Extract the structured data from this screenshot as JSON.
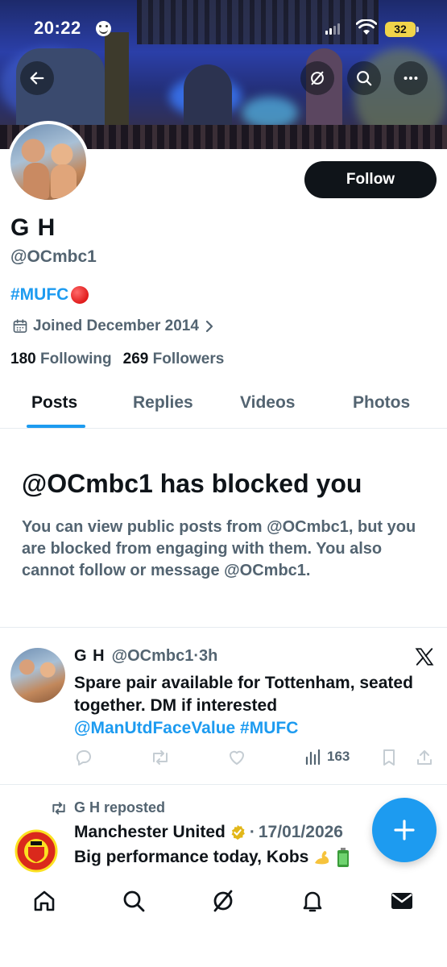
{
  "status_bar": {
    "time": "20:22",
    "battery": "32"
  },
  "profile": {
    "name": "G H",
    "handle": "@OCmbc1",
    "bio": "#MUFC",
    "joined": "Joined December 2014",
    "following_count": "180",
    "following_label": "Following",
    "followers_count": "269",
    "followers_label": "Followers",
    "follow_label": "Follow"
  },
  "tabs": [
    {
      "label": "Posts",
      "active": true
    },
    {
      "label": "Replies",
      "active": false
    },
    {
      "label": "Videos",
      "active": false
    },
    {
      "label": "Photos",
      "active": false
    }
  ],
  "blocked": {
    "title": "@OCmbc1 has blocked you",
    "description": "You can view public posts from @OCmbc1, but you are blocked from engaging with them. You also cannot follow or message @OCmbc1."
  },
  "post": {
    "name": "G H",
    "handle": "@OCmbc1",
    "separator": "·",
    "time": "3h",
    "text": "Spare pair available for Tottenham, seated together. DM if interested",
    "mention": "@ManUtdFaceValue",
    "hashtag": "#MUFC",
    "views": "163"
  },
  "repost": {
    "label": "G H reposted",
    "name": "Manchester United",
    "separator": "·",
    "date": "17/01/2026",
    "text": "Big performance today, Kobs"
  },
  "colors": {
    "accent": "#1d9bf0",
    "text": "#0f1419",
    "muted": "#536471"
  },
  "icons": [
    "back-arrow-icon",
    "grok-icon",
    "search-icon",
    "more-icon",
    "calendar-icon",
    "chevron-right-icon",
    "x-logo-icon",
    "reply-icon",
    "repost-icon",
    "like-icon",
    "views-icon",
    "bookmark-icon",
    "share-icon",
    "plus-icon",
    "home-icon",
    "notifications-icon",
    "messages-icon"
  ]
}
